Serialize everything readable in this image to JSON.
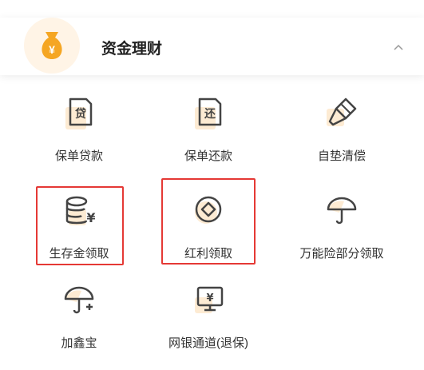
{
  "header": {
    "title": "资金理财",
    "icon": "money-bag-icon",
    "chevron": "chevron-up-icon"
  },
  "colors": {
    "accent": "#f5a623",
    "icon_stroke": "#444444",
    "highlight": "#e53935",
    "soft_bg": "#fdebd3"
  },
  "items": [
    {
      "label": "保单贷款",
      "icon": "loan-document-icon"
    },
    {
      "label": "保单还款",
      "icon": "repayment-document-icon"
    },
    {
      "label": "自垫清偿",
      "icon": "brush-icon"
    },
    {
      "label": "生存金领取",
      "icon": "coin-stack-yen-icon",
      "highlighted": true
    },
    {
      "label": "红利领取",
      "icon": "dividend-coin-icon",
      "highlighted": true
    },
    {
      "label": "万能险部分领取",
      "icon": "umbrella-icon"
    },
    {
      "label": "加鑫宝",
      "icon": "umbrella-plus-icon"
    },
    {
      "label": "网银通道(退保)",
      "icon": "monitor-yen-icon"
    }
  ]
}
